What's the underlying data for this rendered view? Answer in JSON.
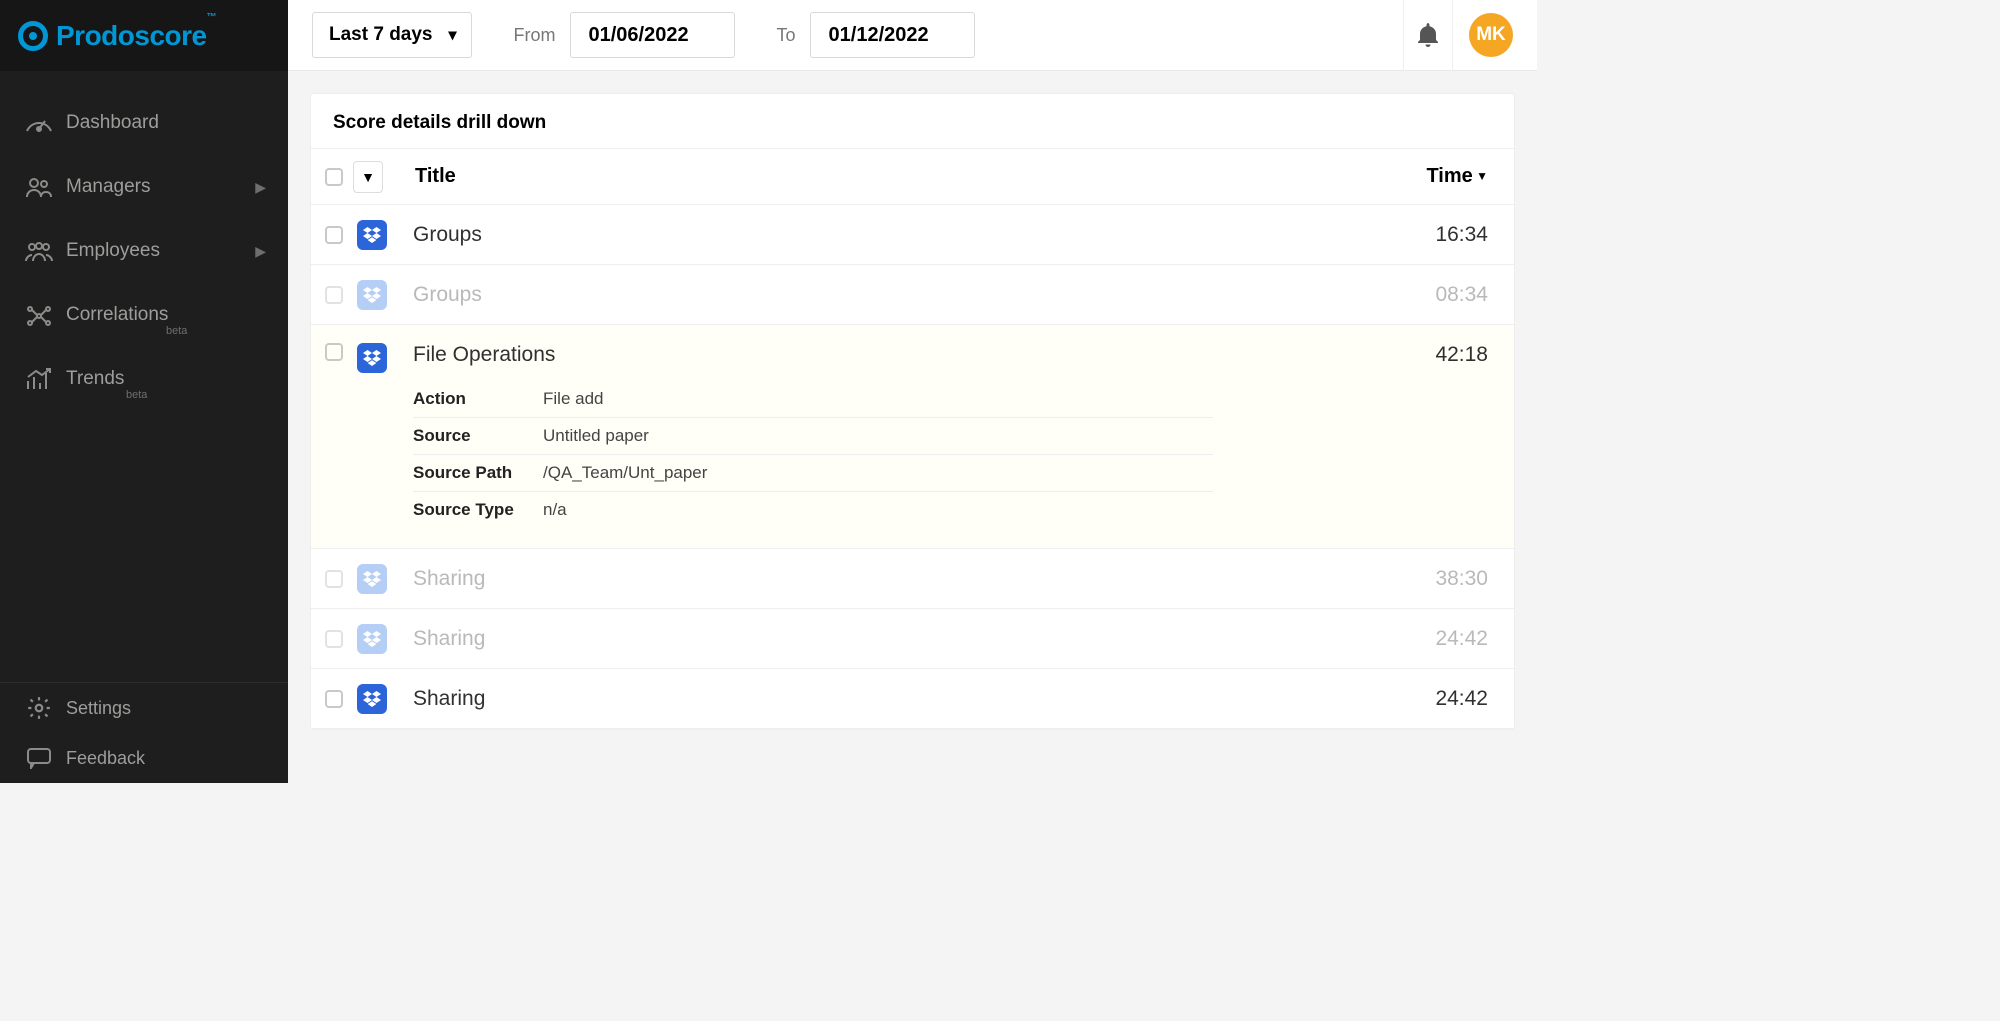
{
  "brand": {
    "name": "Prodoscore",
    "tm": "™"
  },
  "sidebar": {
    "items": [
      {
        "label": "Dashboard",
        "hasSub": false,
        "beta": false
      },
      {
        "label": "Managers",
        "hasSub": true,
        "beta": false
      },
      {
        "label": "Employees",
        "hasSub": true,
        "beta": false
      },
      {
        "label": "Correlations",
        "hasSub": false,
        "beta": true
      },
      {
        "label": "Trends",
        "hasSub": false,
        "beta": true
      }
    ],
    "footer": [
      {
        "label": "Settings"
      },
      {
        "label": "Feedback"
      }
    ],
    "betaTag": "beta"
  },
  "topbar": {
    "rangeLabel": "Last 7 days",
    "fromLabel": "From",
    "fromDate": "01/06/2022",
    "toLabel": "To",
    "toDate": "01/12/2022",
    "avatar": "MK"
  },
  "panel": {
    "title": "Score details drill down",
    "columns": {
      "title": "Title",
      "time": "Time"
    },
    "rows": [
      {
        "title": "Groups",
        "time": "16:34",
        "dim": false,
        "expanded": false
      },
      {
        "title": "Groups",
        "time": "08:34",
        "dim": true,
        "expanded": false
      },
      {
        "title": "File Operations",
        "time": "42:18",
        "dim": false,
        "expanded": true,
        "details": [
          {
            "key": "Action",
            "val": "File add"
          },
          {
            "key": "Source",
            "val": "Untitled paper"
          },
          {
            "key": "Source Path",
            "val": "/QA_Team/Unt_paper"
          },
          {
            "key": "Source Type",
            "val": "n/a"
          }
        ]
      },
      {
        "title": "Sharing",
        "time": "38:30",
        "dim": true,
        "expanded": false
      },
      {
        "title": "Sharing",
        "time": "24:42",
        "dim": true,
        "expanded": false
      },
      {
        "title": "Sharing",
        "time": "24:42",
        "dim": false,
        "expanded": false
      }
    ]
  }
}
